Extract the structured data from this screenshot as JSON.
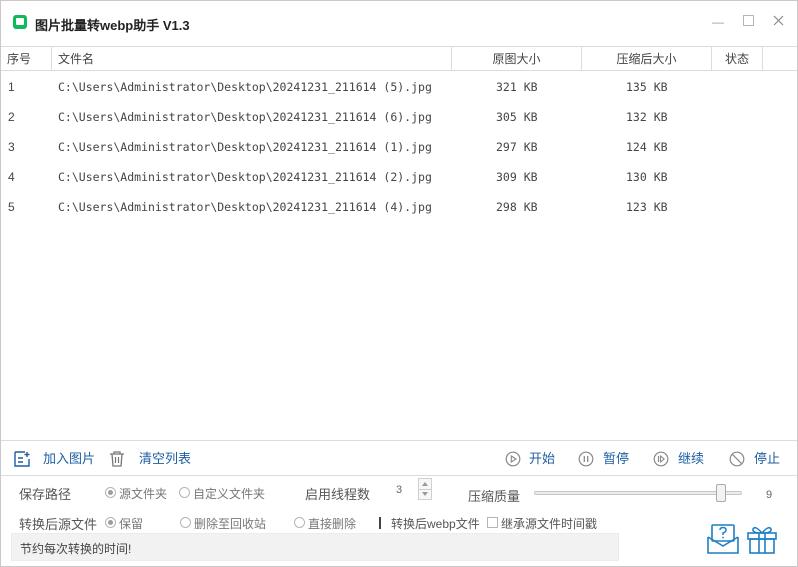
{
  "window": {
    "title": "图片批量转webp助手 V1.3",
    "accent_color": "#12b85c",
    "link_color": "#1d5fa3"
  },
  "table": {
    "columns": [
      "序号",
      "文件名",
      "原图大小",
      "压缩后大小",
      "状态"
    ],
    "rows": [
      {
        "index": "1",
        "file": "C:\\Users\\Administrator\\Desktop\\20241231_211614 (5).jpg",
        "orig": "321 KB",
        "comp": "135 KB",
        "status": ""
      },
      {
        "index": "2",
        "file": "C:\\Users\\Administrator\\Desktop\\20241231_211614 (6).jpg",
        "orig": "305 KB",
        "comp": "132 KB",
        "status": ""
      },
      {
        "index": "3",
        "file": "C:\\Users\\Administrator\\Desktop\\20241231_211614 (1).jpg",
        "orig": "297 KB",
        "comp": "124 KB",
        "status": ""
      },
      {
        "index": "4",
        "file": "C:\\Users\\Administrator\\Desktop\\20241231_211614 (2).jpg",
        "orig": "309 KB",
        "comp": "130 KB",
        "status": ""
      },
      {
        "index": "5",
        "file": "C:\\Users\\Administrator\\Desktop\\20241231_211614 (4).jpg",
        "orig": "298 KB",
        "comp": "123 KB",
        "status": ""
      }
    ]
  },
  "toolbar": {
    "add_images": "加入图片",
    "clear_list": "清空列表",
    "start": "开始",
    "pause": "暂停",
    "resume": "继续",
    "stop": "停止"
  },
  "settings": {
    "save_path_label": "保存路径",
    "save_path_options": [
      "源文件夹",
      "自定义文件夹"
    ],
    "save_path_selected": "源文件夹",
    "threads_label": "启用线程数",
    "threads_value": "3",
    "quality_label": "压缩质量",
    "quality_value": "9",
    "quality_fraction": 0.9,
    "source_file_label": "转换后源文件",
    "source_file_options": [
      "保留",
      "删除至回收站",
      "直接删除"
    ],
    "source_file_selected": "保留",
    "webp_label": "转换后webp文件",
    "inherit_time_label": "继承源文件时间戳",
    "inherit_time_checked": false
  },
  "status": {
    "message": "节约每次转换的时间!"
  }
}
